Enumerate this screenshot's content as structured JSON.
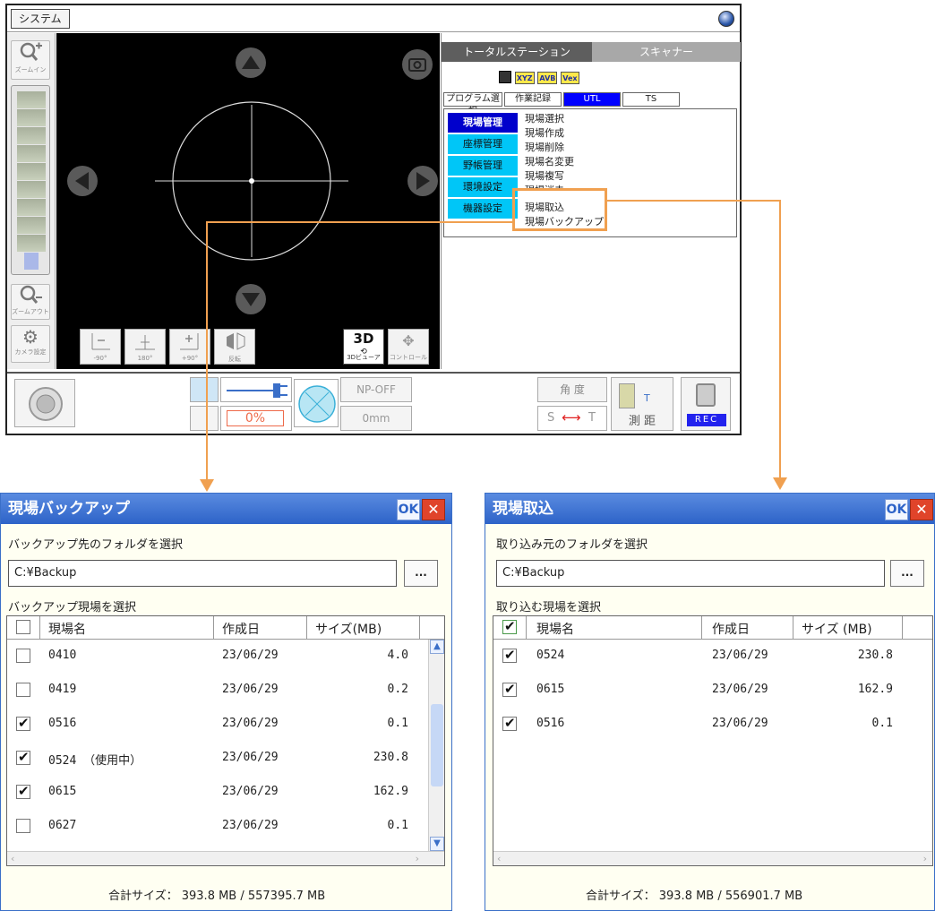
{
  "main_window": {
    "system_button": "システム",
    "viewer": {
      "zoom_in_label": "ズームイン",
      "zoom_out_label": "ズームアウト",
      "camera_settings_label": "カメラ設定",
      "view_buttons": [
        "-90°",
        "180°",
        "+90°",
        "反転"
      ],
      "viewer_3d_label": "3Dビューア",
      "viewer_3d_icon_text": "3D",
      "control_label": "コントロール"
    },
    "right_panel": {
      "top_tabs": [
        "トータルステーション",
        "スキャナー"
      ],
      "toolbar_icons": [
        "XYZ",
        "AVB",
        "Vex"
      ],
      "prog_tabs": [
        "プログラム選択",
        "作業記録",
        "UTL",
        "TS"
      ],
      "categories": [
        "現場管理",
        "座標管理",
        "野帳管理",
        "環境設定",
        "機器設定"
      ],
      "menu_items": [
        "現場選択",
        "現場作成",
        "現場削除",
        "現場名変更",
        "現場複写",
        "現場消去",
        "現場取込",
        "現場バックアップ"
      ]
    },
    "status_bar": {
      "battery_percent": "0%",
      "np_mode": "NP-OFF",
      "offset": "0mm",
      "angle_label": "角 度",
      "st_label": "S",
      "st_label2": "T",
      "measure_label": "測 距",
      "instrument_t": "T",
      "rec_label": "REC"
    }
  },
  "backup_dialog": {
    "title": "現場バックアップ",
    "ok_label": "OK",
    "close_label": "✕",
    "folder_prompt": "バックアップ先のフォルダを選択",
    "folder_path": "C:¥Backup",
    "browse_label": "...",
    "list_prompt": "バックアップ現場を選択",
    "columns": [
      "現場名",
      "作成日",
      "サイズ(MB)"
    ],
    "rows": [
      {
        "checked": false,
        "name": "0410",
        "date": "23/06/29",
        "size": "4.0"
      },
      {
        "checked": false,
        "name": "0419",
        "date": "23/06/29",
        "size": "0.2"
      },
      {
        "checked": true,
        "name": "0516",
        "date": "23/06/29",
        "size": "0.1"
      },
      {
        "checked": true,
        "name": "0524 （使用中）",
        "date": "23/06/29",
        "size": "230.8"
      },
      {
        "checked": true,
        "name": "0615",
        "date": "23/06/29",
        "size": "162.9"
      },
      {
        "checked": false,
        "name": "0627",
        "date": "23/06/29",
        "size": "0.1"
      }
    ],
    "total": "合計サイズ：  393.8  MB / 557395.7  MB"
  },
  "import_dialog": {
    "title": "現場取込",
    "ok_label": "OK",
    "close_label": "✕",
    "folder_prompt": "取り込み元のフォルダを選択",
    "folder_path": "C:¥Backup",
    "browse_label": "...",
    "list_prompt": "取り込む現場を選択",
    "columns": [
      "現場名",
      "作成日",
      "サイズ (MB)"
    ],
    "rows": [
      {
        "checked": true,
        "name": "0524",
        "date": "23/06/29",
        "size": "230.8"
      },
      {
        "checked": true,
        "name": "0615",
        "date": "23/06/29",
        "size": "162.9"
      },
      {
        "checked": true,
        "name": "0516",
        "date": "23/06/29",
        "size": "0.1"
      }
    ],
    "total": "合計サイズ：  393.8  MB / 556901.7  MB"
  },
  "colors": {
    "accent_tab": "#0000ff",
    "category": "#00c6f7",
    "annotation": "#f0a050",
    "dialog_title": "#2d63c8"
  }
}
